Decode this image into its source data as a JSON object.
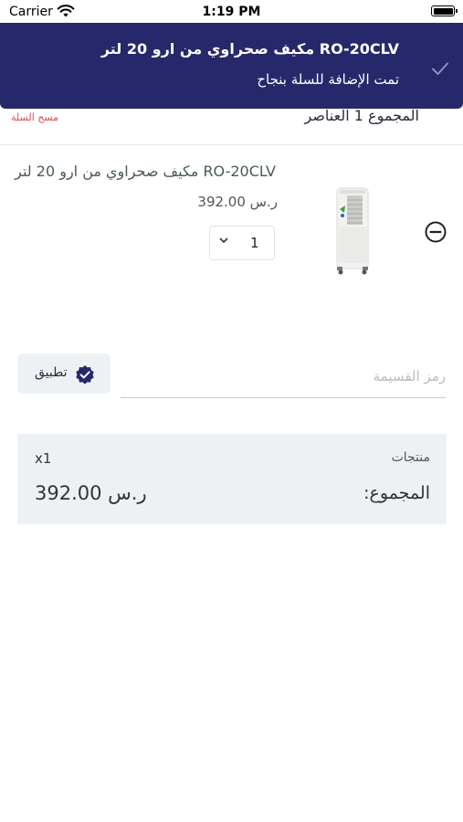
{
  "status_bar": {
    "carrier": "Carrier",
    "time": "1:19 PM"
  },
  "toast": {
    "title": "RO-20CLV مكيف صحراوي من ارو 20 لتر",
    "subtitle": "تمت الإضافة للسلة بنجاح"
  },
  "summary": {
    "count_text": "المجموع  1 العناصر",
    "clear_label": "مسح السلة"
  },
  "cart_item": {
    "name": "RO-20CLV مكيف صحراوي من ارو 20 لتر",
    "price": "ر.س 392.00",
    "quantity": "1"
  },
  "coupon": {
    "placeholder": "رمز القسيمة",
    "value": "",
    "apply_label": "تطبيق"
  },
  "totals": {
    "products_label": "منتجات",
    "products_count": "x1",
    "total_label": "المجموع:",
    "total_value": "ر.س 392.00"
  },
  "colors": {
    "toast_bg": "#27286b",
    "accent": "#27286b",
    "danger": "#e04b4b",
    "panel_bg": "#eef1f4"
  },
  "icons": {
    "status": [
      "wifi-icon",
      "battery-icon"
    ],
    "toast": "checkmark-icon",
    "item": [
      "chevron-down-icon",
      "remove-circle-icon"
    ],
    "apply": "verified-badge-icon"
  }
}
